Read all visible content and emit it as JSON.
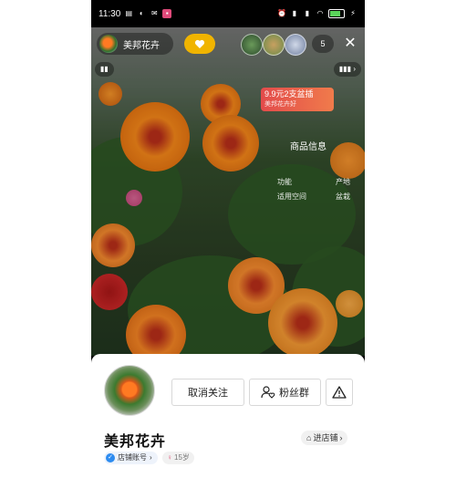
{
  "status_bar": {
    "time": "11:30",
    "left_icons": [
      "notification-icon",
      "app-icon",
      "app-icon",
      "app-icon"
    ],
    "right_icons": [
      "alarm-icon",
      "hd-icon",
      "signal-icon",
      "wifi-icon",
      "battery-icon",
      "charging-icon"
    ]
  },
  "live": {
    "anchor_name": "美邦花卉",
    "viewer_count": "5",
    "promo_text": "9.9元2支盆插",
    "promo_sub": "美邦花卉好",
    "product_info_title": "商品信息",
    "product_info_items": [
      "功能",
      "适用空间",
      "产地",
      "盆栽"
    ]
  },
  "profile": {
    "unfollow_label": "取消关注",
    "fans_group_label": "粉丝群",
    "report_icon": "warning-icon",
    "shop_name": "美邦花卉",
    "enter_shop_label": "进店铺",
    "account_badge_label": "店铺账号",
    "age_badge_label": "15岁"
  },
  "colors": {
    "accent": "#2d8cf0",
    "follow_bubble": "#f0b400",
    "promo": "#e34b4b"
  }
}
